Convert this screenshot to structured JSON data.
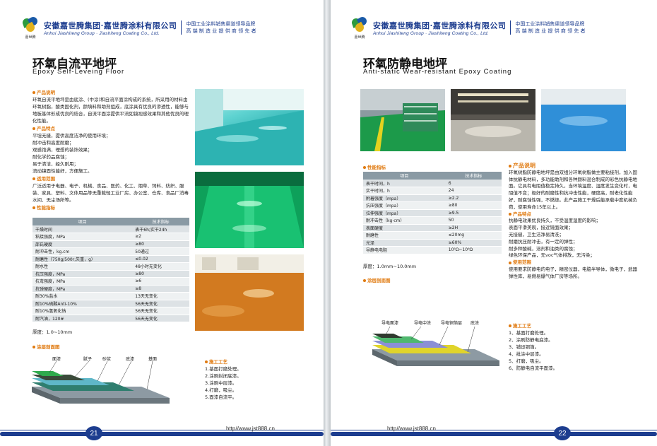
{
  "header": {
    "company_cn": "安徽嘉世腾集团·嘉世腾涂料有限公司",
    "company_en": "Anhui Jiashiteng Group · Jiashiteng Coating Co., Ltd.",
    "slogan1": "中国工业涂料销售渠道领导品牌",
    "slogan2": "高 端 制 造 业 提 供 商 领 先 者",
    "logo_text": "嘉世腾"
  },
  "left": {
    "title_cn": "环氧自流平地坪",
    "title_en": "Epoxy Self-Leveing Floor",
    "s1_h": "产品说明",
    "s1_body": "环氧自流平地坪是由底涂、(中涂)和自流平面涂构成的系统，所采用的材料由环氧树脂，酸类固化剂，颜填料和助剂组成，底涂具有优良的渗透性，能够与地板基体形成优良的结合，自流平面涂提供平流如镜视感效果和其他优良的理化性能。",
    "s2_h": "产品特点",
    "s2_items": [
      "平坦无缝，提供高度洁净的使用环境；",
      "耐冲击和高度耐磨；",
      "观感饱满，理想的装饰效果；",
      "耐化学药品腐蚀；",
      "易于清洁，经久耐用；",
      "流动镜面性能好，方便施工。"
    ],
    "s3_h": "适用范围",
    "s3_body": "广泛适用于电器、电子、机械、食品、医药、化工、烟草、饲料、纺织、服装、家具、塑料、文体用品等无重载轻工业厂房、办公室、仓库、食品厂消毒水间、无尘场所等。",
    "s4_h": "性能指标",
    "table_head": [
      "项目",
      "技术指标"
    ],
    "table_rows": [
      [
        "干燥时间",
        "表干6h;实干24h"
      ],
      [
        "粘接强度，MPa",
        "≥2"
      ],
      [
        "邵氏硬度",
        "≥80"
      ],
      [
        "耐冲击性，kg.cm",
        "50通过"
      ],
      [
        "耐磨性（750g/500r,失重，g）",
        "≤0.02"
      ],
      [
        "耐水性",
        "48小时无变化"
      ],
      [
        "抗压强度，MPa",
        "≥80"
      ],
      [
        "抗弯强度，MPa",
        "≥6"
      ],
      [
        "抗弹硬度，MPa",
        "≥8"
      ],
      [
        "耐30%盐水",
        "13天无变化"
      ],
      [
        "耐10%硫酸Anti-10%",
        "56天无变化"
      ],
      [
        "耐10%氢氧化钠",
        "56天无变化"
      ],
      [
        "耐汽油，120#",
        "56天无变化"
      ]
    ],
    "thickness": "厚度：1.0~10mm",
    "s5_h": "涂层剖面图",
    "layers": [
      "面漆",
      "腻子",
      "砂浆",
      "底漆",
      "基面"
    ],
    "s6_h": "施工工艺",
    "steps": [
      "1.基面打磨处理。",
      "2.涂刷封闭底漆。",
      "3.涂刷中层漆。",
      "4.打磨，吸尘。",
      "5.面漆自流平。"
    ],
    "url": "http//www.jst888.cn",
    "page": "21"
  },
  "right": {
    "title_cn": "环氧防静电地坪",
    "title_en": "Anti-static Wear-resistant Epoxy Coating",
    "s1_h": "性能指标",
    "table_head": [
      "项目",
      "技术指标"
    ],
    "table_rows": [
      [
        "表干时间，h",
        "6"
      ],
      [
        "实干时间，h",
        "24"
      ],
      [
        "附着强度（mpa）",
        "≥2.2"
      ],
      [
        "抗压强度（mpa）",
        "≥80"
      ],
      [
        "拉伸强度（mpa）",
        "≥9.5"
      ],
      [
        "耐冲击性（kg·cm）",
        "50"
      ],
      [
        "表面硬度",
        "≥2H"
      ],
      [
        "耐磨性",
        "≤20mg"
      ],
      [
        "光泽",
        "≥60%"
      ],
      [
        "导静电电阻",
        "10⁵Ω~10⁹Ω"
      ]
    ],
    "thickness": "厚度：1.0mm~10.0mm",
    "s2_h": "产品说明",
    "s2_body": "环氧树脂防静电地坪是由双组分环氧树脂做主要粘接剂，加入固体抗静电材料，多功能助剂和各种颜料混合制成的彩色抗静电地面。它具有电阻值稳定持久，当环境温度、湿度发生变化时，电阻值不变；极好的耐磨性和抗冲击性能，硬度高，耐老化性能好，耐腐蚀性强，不燃烧。此产品施工干燥后能承载中度机械负荷，使用寿命15年以上。",
    "s3_h": "产品特点",
    "s3_items": [
      "抗静电效果优良持久，不受温度湿度的影响；",
      "表面平滑美观，接近镜面效果；",
      "无接缝，卫生洁净易清洗；",
      "耐磨抗压耐冲击，有一定的弹性；",
      "耐多种酸碱，溶剂和油类的腐蚀；",
      "绿色环保产品，无voc气体排放，无污染；"
    ],
    "s4_h": "使用范围",
    "s4_body": "使用要求防静电的电子，精密仪器，电脑半导体，微电子，武器弹性库，易燃易爆气体厂房等场所。",
    "s5_h": "涂层剖面图",
    "layers": [
      "导电面漆",
      "导电中涂",
      "导电铜箔层",
      "底涂"
    ],
    "s6_h": "施工工艺",
    "steps": [
      "1、基面打磨处理。",
      "2、涂刷防静电底漆。",
      "3、铺设铜箔。",
      "4、批涂中层漆。",
      "5、打磨，吸尘。",
      "6、防静电自流平面漆。"
    ],
    "url": "http//www.jst888.cn",
    "page": "22"
  }
}
